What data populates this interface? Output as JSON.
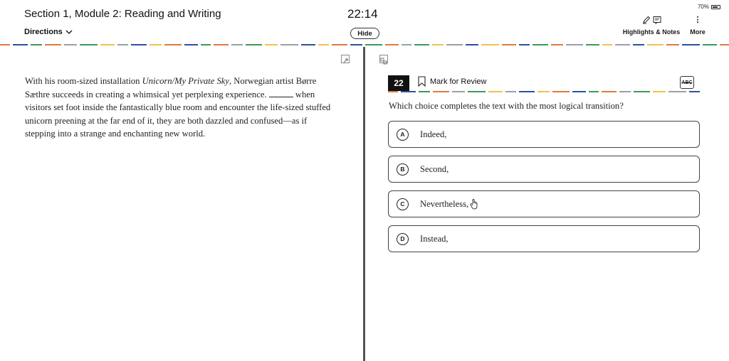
{
  "header": {
    "section_title": "Section 1, Module 2: Reading and Writing",
    "directions_label": "Directions",
    "timer": "22:14",
    "hide_label": "Hide",
    "battery": "70%",
    "highlights_label": "Highlights & Notes",
    "more_label": "More"
  },
  "passage": {
    "part1": "With his room-sized installation ",
    "title_italic": "Unicorn/My Private Sky",
    "part2": ", Norwegian artist Børre Sæthre succeeds in creating a whimsical yet perplexing experience. ",
    "part3": " when visitors set foot inside the fantastically blue room and encounter the life-sized stuffed unicorn preening at the far end of it, they are both dazzled and confused—as if stepping into a strange and enchanting new world."
  },
  "question": {
    "number": "22",
    "mark_review_label": "Mark for Review",
    "abc_label": "ABC",
    "prompt": "Which choice completes the text with the most logical transition?",
    "options": [
      {
        "letter": "A",
        "text": "Indeed,"
      },
      {
        "letter": "B",
        "text": "Second,"
      },
      {
        "letter": "C",
        "text": "Nevertheless,"
      },
      {
        "letter": "D",
        "text": "Instead,"
      }
    ]
  },
  "colors": {
    "dash_palette": [
      "#e07a3f",
      "#f2c14e",
      "#3a9a5b",
      "#2e4fa3",
      "#9aa0a6"
    ]
  }
}
